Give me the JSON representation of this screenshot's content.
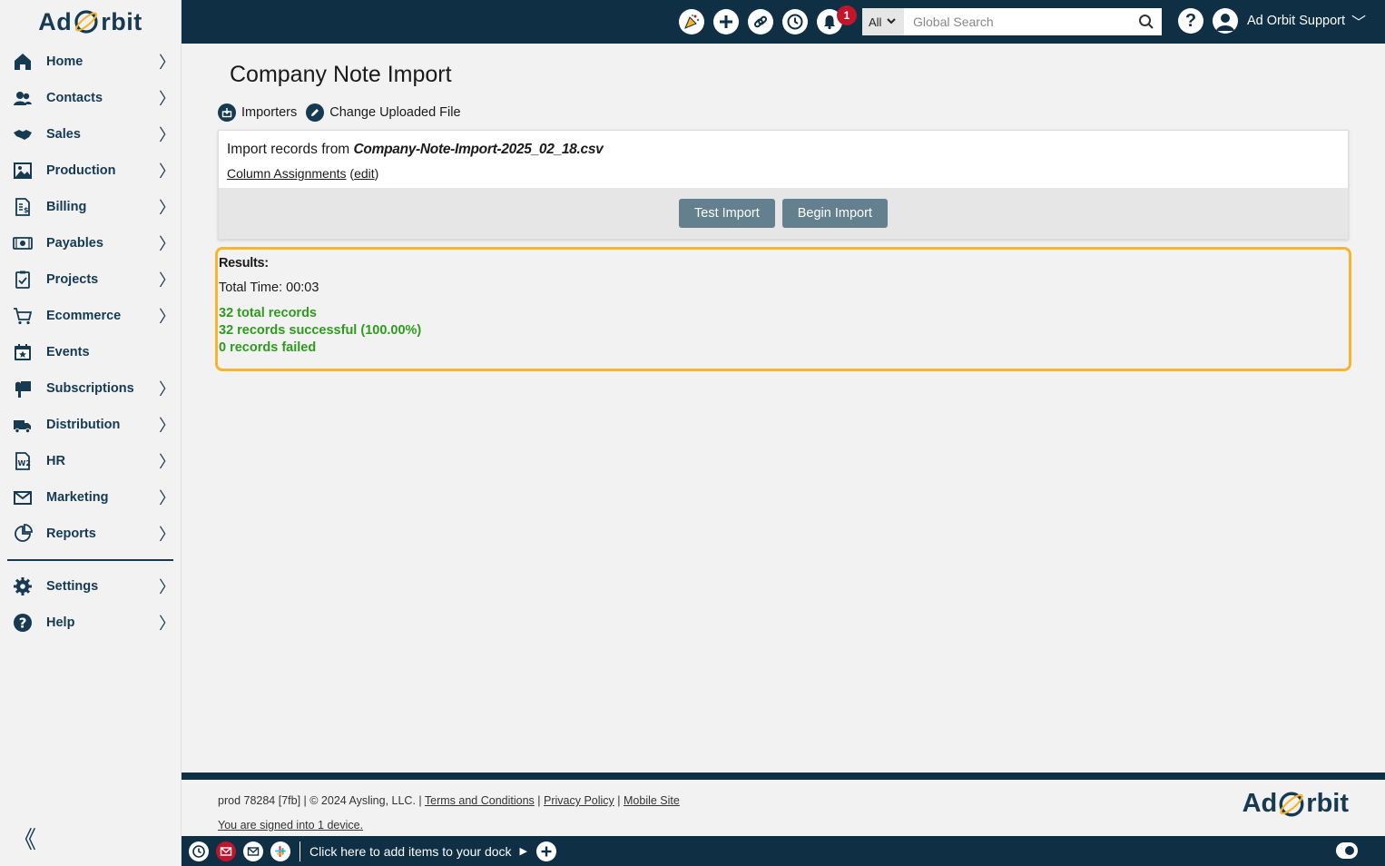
{
  "brand": {
    "logo_left": "Ad",
    "logo_right": "rbit"
  },
  "sidebar": {
    "items": [
      {
        "label": "Home",
        "icon": "home-icon",
        "chevron": true
      },
      {
        "label": "Contacts",
        "icon": "contacts-icon",
        "chevron": true
      },
      {
        "label": "Sales",
        "icon": "handshake-icon",
        "chevron": true
      },
      {
        "label": "Production",
        "icon": "image-icon",
        "chevron": true
      },
      {
        "label": "Billing",
        "icon": "invoice-icon",
        "chevron": true
      },
      {
        "label": "Payables",
        "icon": "money-icon",
        "chevron": true
      },
      {
        "label": "Projects",
        "icon": "clipboard-icon",
        "chevron": true
      },
      {
        "label": "Ecommerce",
        "icon": "cart-icon",
        "chevron": true
      },
      {
        "label": "Events",
        "icon": "calendar-icon",
        "chevron": false
      },
      {
        "label": "Subscriptions",
        "icon": "mailbox-icon",
        "chevron": true
      },
      {
        "label": "Distribution",
        "icon": "truck-icon",
        "chevron": true
      },
      {
        "label": "HR",
        "icon": "w2-icon",
        "chevron": true
      },
      {
        "label": "Marketing",
        "icon": "envelope-icon",
        "chevron": true
      },
      {
        "label": "Reports",
        "icon": "chart-icon",
        "chevron": true
      }
    ],
    "bottom_items": [
      {
        "label": "Settings",
        "icon": "gear-icon",
        "chevron": true
      },
      {
        "label": "Help",
        "icon": "help-icon",
        "chevron": true
      }
    ],
    "chevron_glyph": "〉",
    "collapse_glyph": "《"
  },
  "topbar": {
    "notification_count": "1",
    "search_scope": "All",
    "search_placeholder": "Global Search",
    "help_glyph": "?",
    "user_name": "Ad Orbit Support",
    "user_chevron": "﹀"
  },
  "page": {
    "title": "Company Note Import",
    "actions": {
      "importers": "Importers",
      "change_file": "Change Uploaded File"
    },
    "card": {
      "import_prefix": "Import records from ",
      "file_name": "Company-Note-Import-2025_02_18.csv",
      "column_assignments": "Column Assignments",
      "edit_open": " (",
      "edit": "edit",
      "edit_close": ")",
      "test_button": "Test Import",
      "begin_button": "Begin Import"
    },
    "results": {
      "title": "Results:",
      "total_time": "Total Time: 00:03",
      "lines": [
        "32 total records",
        "32 records successful (100.00%)",
        "0 records failed"
      ]
    }
  },
  "footer": {
    "build": "prod 78284 [7fb] | © 2024 Aysling, LLC. | ",
    "terms": "Terms and Conditions",
    "sep": " | ",
    "privacy": "Privacy Policy",
    "mobile": "Mobile Site",
    "signed_in": "You are signed into 1 device."
  },
  "dock": {
    "text": "Click here to add items to your dock",
    "arrow": "▶"
  },
  "colors": {
    "navy": "#0e2f44",
    "brand": "#153a52",
    "accent_orange": "#f7b42c",
    "success_green": "#2e9b1e",
    "button": "#64808f",
    "badge_red": "#c0152b"
  }
}
